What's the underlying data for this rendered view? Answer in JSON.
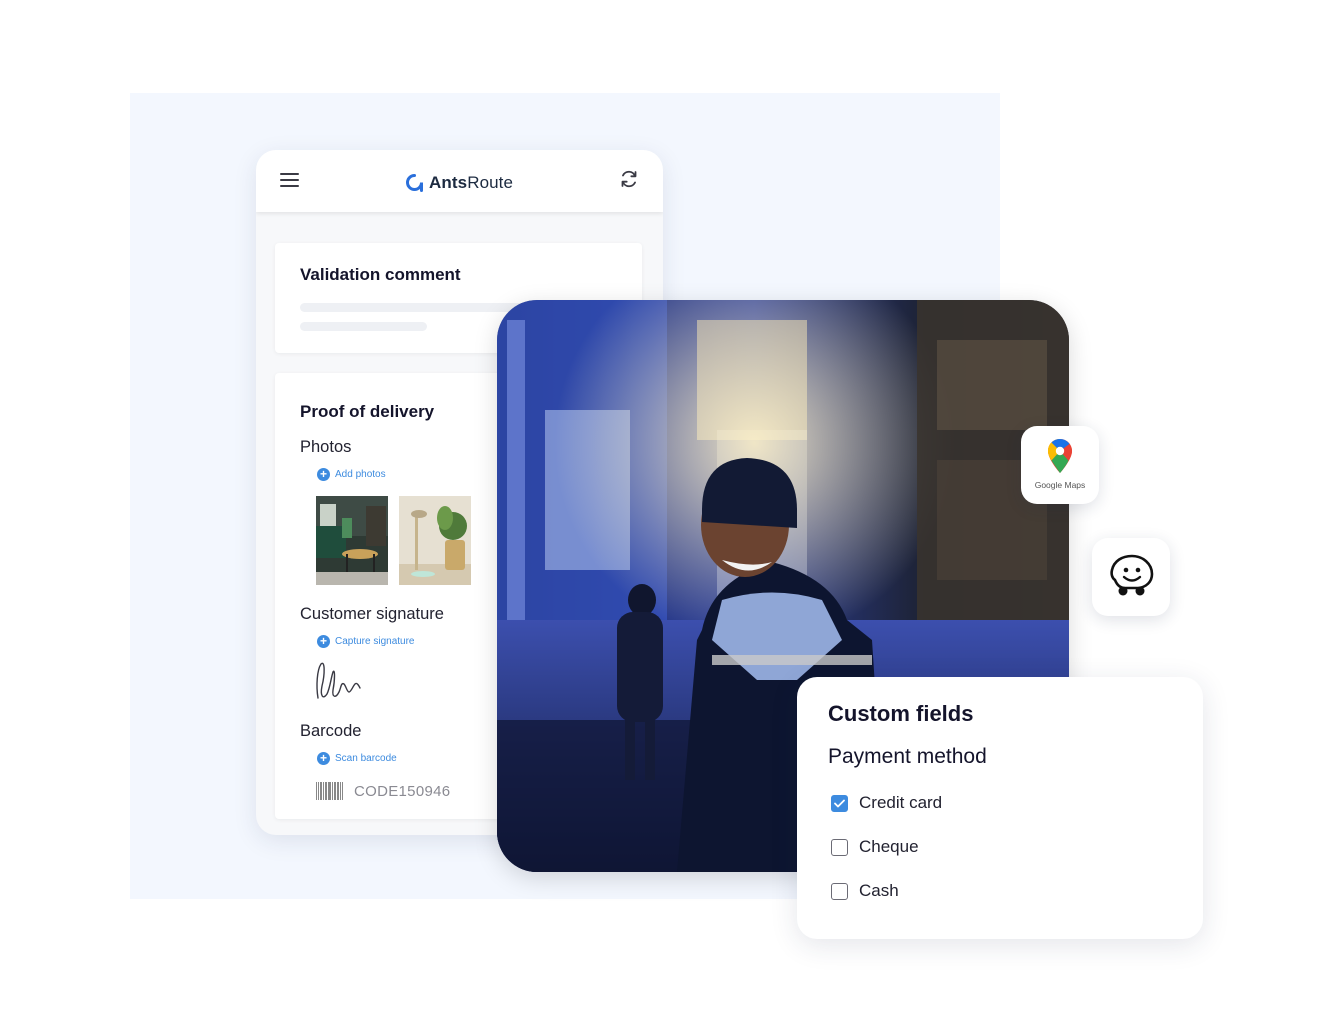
{
  "app": {
    "brand_bold": "Ants",
    "brand_regular": "Route",
    "brand_color": "#1c2a40",
    "logo_color": "#2a6fdb"
  },
  "header": {
    "menu_icon": "hamburger-menu-icon",
    "refresh_icon": "refresh-icon"
  },
  "validation": {
    "title": "Validation comment"
  },
  "pod": {
    "title": "Proof of delivery",
    "photos_label": "Photos",
    "add_photos": "Add photos",
    "signature_label": "Customer signature",
    "capture_signature": "Capture signature",
    "barcode_label": "Barcode",
    "scan_barcode": "Scan barcode",
    "barcode_value": "CODE150946"
  },
  "integrations": {
    "google_maps_label": "Google Maps",
    "waze_icon": "waze-icon"
  },
  "custom_fields": {
    "title": "Custom fields",
    "subtitle": "Payment method",
    "options": [
      {
        "label": "Credit card",
        "checked": true
      },
      {
        "label": "Cheque",
        "checked": false
      },
      {
        "label": "Cash",
        "checked": false
      }
    ]
  },
  "colors": {
    "accent": "#3d8bdf",
    "panel_bg": "#f3f7fe"
  }
}
